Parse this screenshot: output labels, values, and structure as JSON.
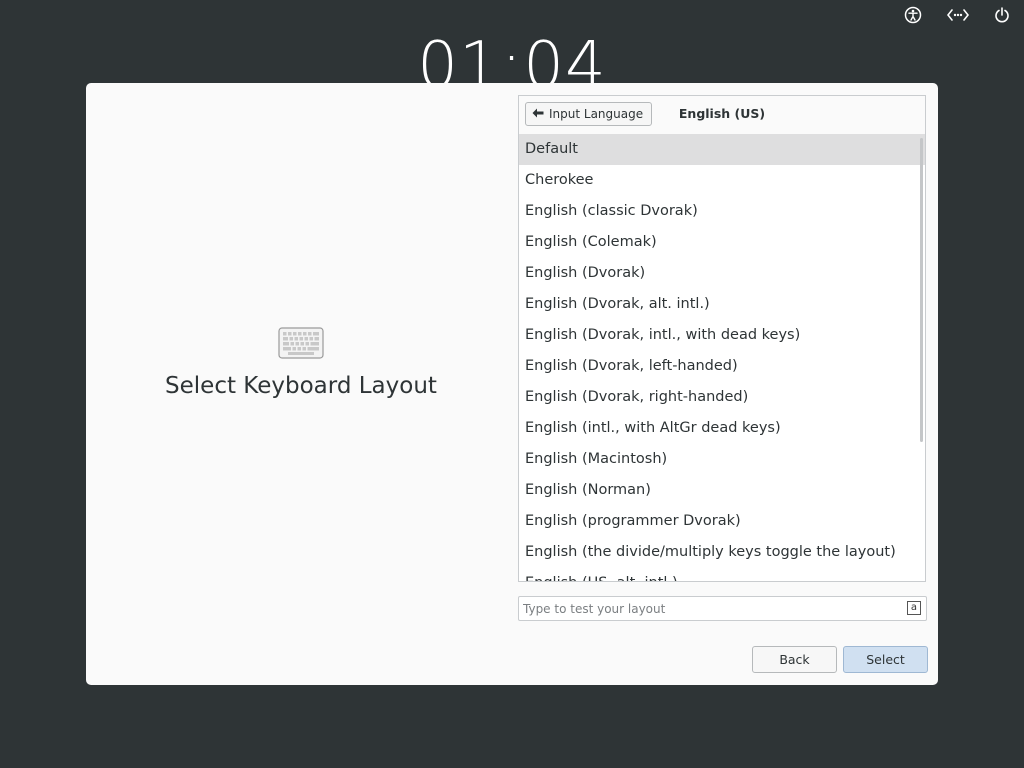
{
  "topbar": {
    "icons": [
      "accessibility-icon",
      "network-icon",
      "power-icon"
    ]
  },
  "clock": {
    "time": "01:04"
  },
  "left_pane": {
    "icon": "keyboard-icon",
    "title": "Select Keyboard Layout"
  },
  "header": {
    "back_button_label": "Input Language",
    "title": "English (US)"
  },
  "layouts": {
    "selected_index": 0,
    "items": [
      "Default",
      "Cherokee",
      "English (classic Dvorak)",
      "English (Colemak)",
      "English (Dvorak)",
      "English (Dvorak, alt. intl.)",
      "English (Dvorak, intl., with dead keys)",
      "English (Dvorak, left-handed)",
      "English (Dvorak, right-handed)",
      "English (intl., with AltGr dead keys)",
      "English (Macintosh)",
      "English (Norman)",
      "English (programmer Dvorak)",
      "English (the divide/multiply keys toggle the layout)",
      "English (US, alt. intl.)"
    ]
  },
  "test_field": {
    "placeholder": "Type to test your layout",
    "value": "",
    "icon_glyph": "a"
  },
  "buttons": {
    "back": "Back",
    "select": "Select"
  },
  "colors": {
    "background": "#2e3436",
    "dialog": "#fafafa",
    "selected_row": "#dededf",
    "primary_button": "#d0e0f1"
  }
}
